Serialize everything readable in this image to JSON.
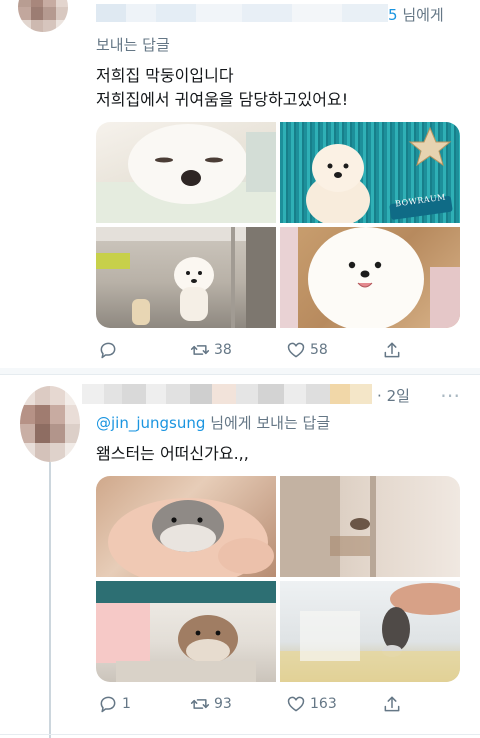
{
  "tweet1": {
    "time": "5",
    "header_suffix": "님에게",
    "reply_to_label": "보내는 답글",
    "line1": "저희집 막둥이입니다",
    "line2": "저희집에서 귀여움을 담당하고있어요!",
    "photos": [
      {
        "icon": "dog-photo",
        "desc": "white fluffy puppy"
      },
      {
        "icon": "dog-photo",
        "desc": "pomeranian with star"
      },
      {
        "icon": "dog-photo",
        "desc": "puppy standing at door"
      },
      {
        "icon": "dog-photo",
        "desc": "pomeranian close-up"
      }
    ],
    "photo_overlay_text": "BOWRAUM",
    "actions": {
      "reply": "",
      "retweet": "38",
      "like": "58"
    }
  },
  "tweet2": {
    "time": "2일",
    "handle": "@jin_jungsung",
    "reply_suffix": "님에게 보내는 답글",
    "text": "왬스터는 어떠신가요.,,",
    "photos": [
      {
        "icon": "hamster-photo",
        "desc": "hamster in hand"
      },
      {
        "icon": "hamster-photo",
        "desc": "hamster cage corner"
      },
      {
        "icon": "hamster-photo",
        "desc": "hamster on toy"
      },
      {
        "icon": "hamster-photo",
        "desc": "hamster held over bag"
      }
    ],
    "actions": {
      "reply": "1",
      "retweet": "93",
      "like": "163"
    }
  },
  "colors": {
    "accent": "#1b95e0",
    "muted": "#657786",
    "divider": "#e6ecf0"
  }
}
